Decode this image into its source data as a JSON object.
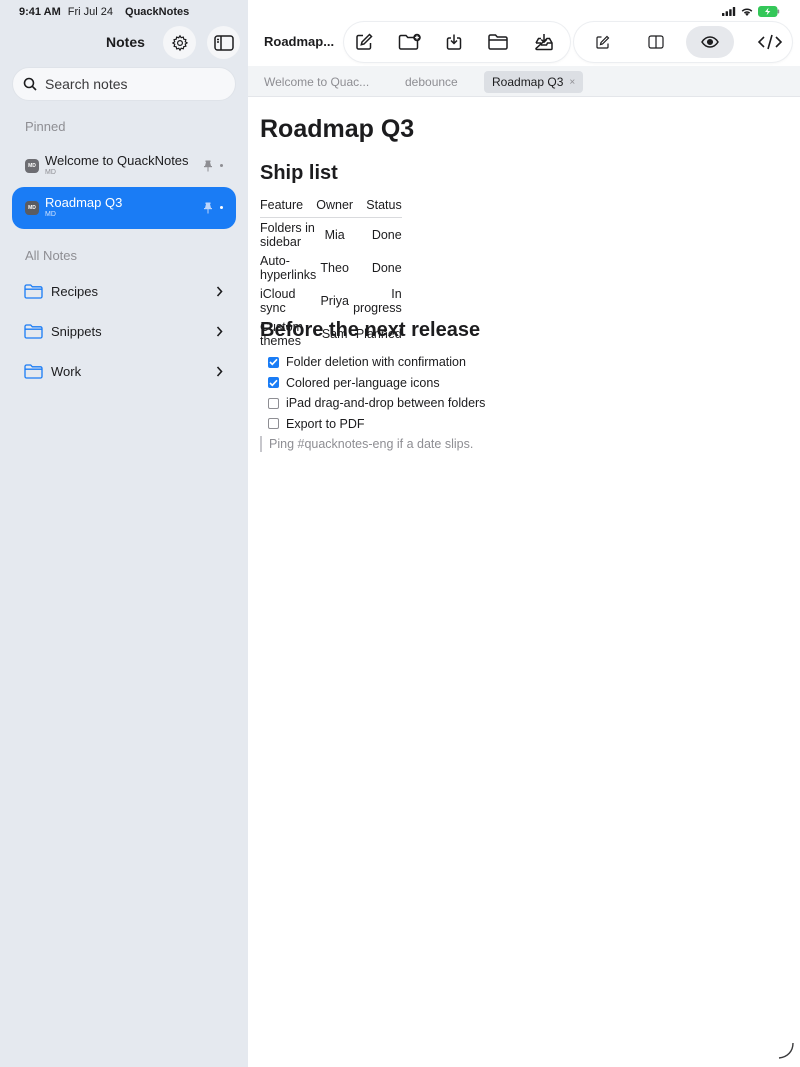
{
  "status_bar": {
    "time": "9:41 AM",
    "date": "Fri Jul 24",
    "app_name": "QuackNotes"
  },
  "sidebar": {
    "title": "Notes",
    "settings_icon": "gear-icon",
    "toggle_icon": "sidebar-toggle-icon",
    "search_placeholder": "Search notes",
    "pinned_label": "Pinned",
    "pinned": [
      {
        "title": "Welcome to QuackNotes",
        "type": "MD",
        "active": false
      },
      {
        "title": "Roadmap Q3",
        "type": "MD",
        "active": true
      }
    ],
    "all_notes_label": "All Notes",
    "folders": [
      {
        "name": "Recipes"
      },
      {
        "name": "Snippets"
      },
      {
        "name": "Work"
      }
    ]
  },
  "main": {
    "doc_title": "Roadmap...",
    "toolbar": {
      "icons": [
        "compose-icon",
        "new-folder-icon",
        "download-icon",
        "folder-icon",
        "import-icon",
        "edit-mode-icon",
        "split-view-icon",
        "preview-eye-icon",
        "code-view-icon"
      ]
    },
    "tabs": [
      {
        "label": "Welcome to Quac...",
        "active": false
      },
      {
        "label": "debounce",
        "active": false
      },
      {
        "label": "Roadmap Q3",
        "active": true,
        "close": "×"
      }
    ],
    "document": {
      "h1": "Roadmap Q3",
      "ship_heading": "Ship list",
      "table": {
        "headers": [
          "Feature",
          "Owner",
          "Status"
        ],
        "rows": [
          [
            "Folders in sidebar",
            "Mia",
            "Done"
          ],
          [
            "Auto-hyperlinks",
            "Theo",
            "Done"
          ],
          [
            "iCloud sync",
            "Priya",
            "In progress"
          ],
          [
            "Custom themes",
            "Sam",
            "Planned"
          ]
        ]
      },
      "release_heading": "Before the next release",
      "tasks": [
        {
          "text": "Folder deletion with confirmation",
          "done": true
        },
        {
          "text": "Colored per-language icons",
          "done": true
        },
        {
          "text": "iPad drag-and-drop between folders",
          "done": false
        },
        {
          "text": "Export to PDF",
          "done": false
        }
      ],
      "quote": "Ping #quacknotes-eng if a date slips."
    }
  },
  "colors": {
    "accent": "#1a7cf5",
    "sidebar_bg": "#e5e9ef",
    "battery": "#34c759"
  }
}
